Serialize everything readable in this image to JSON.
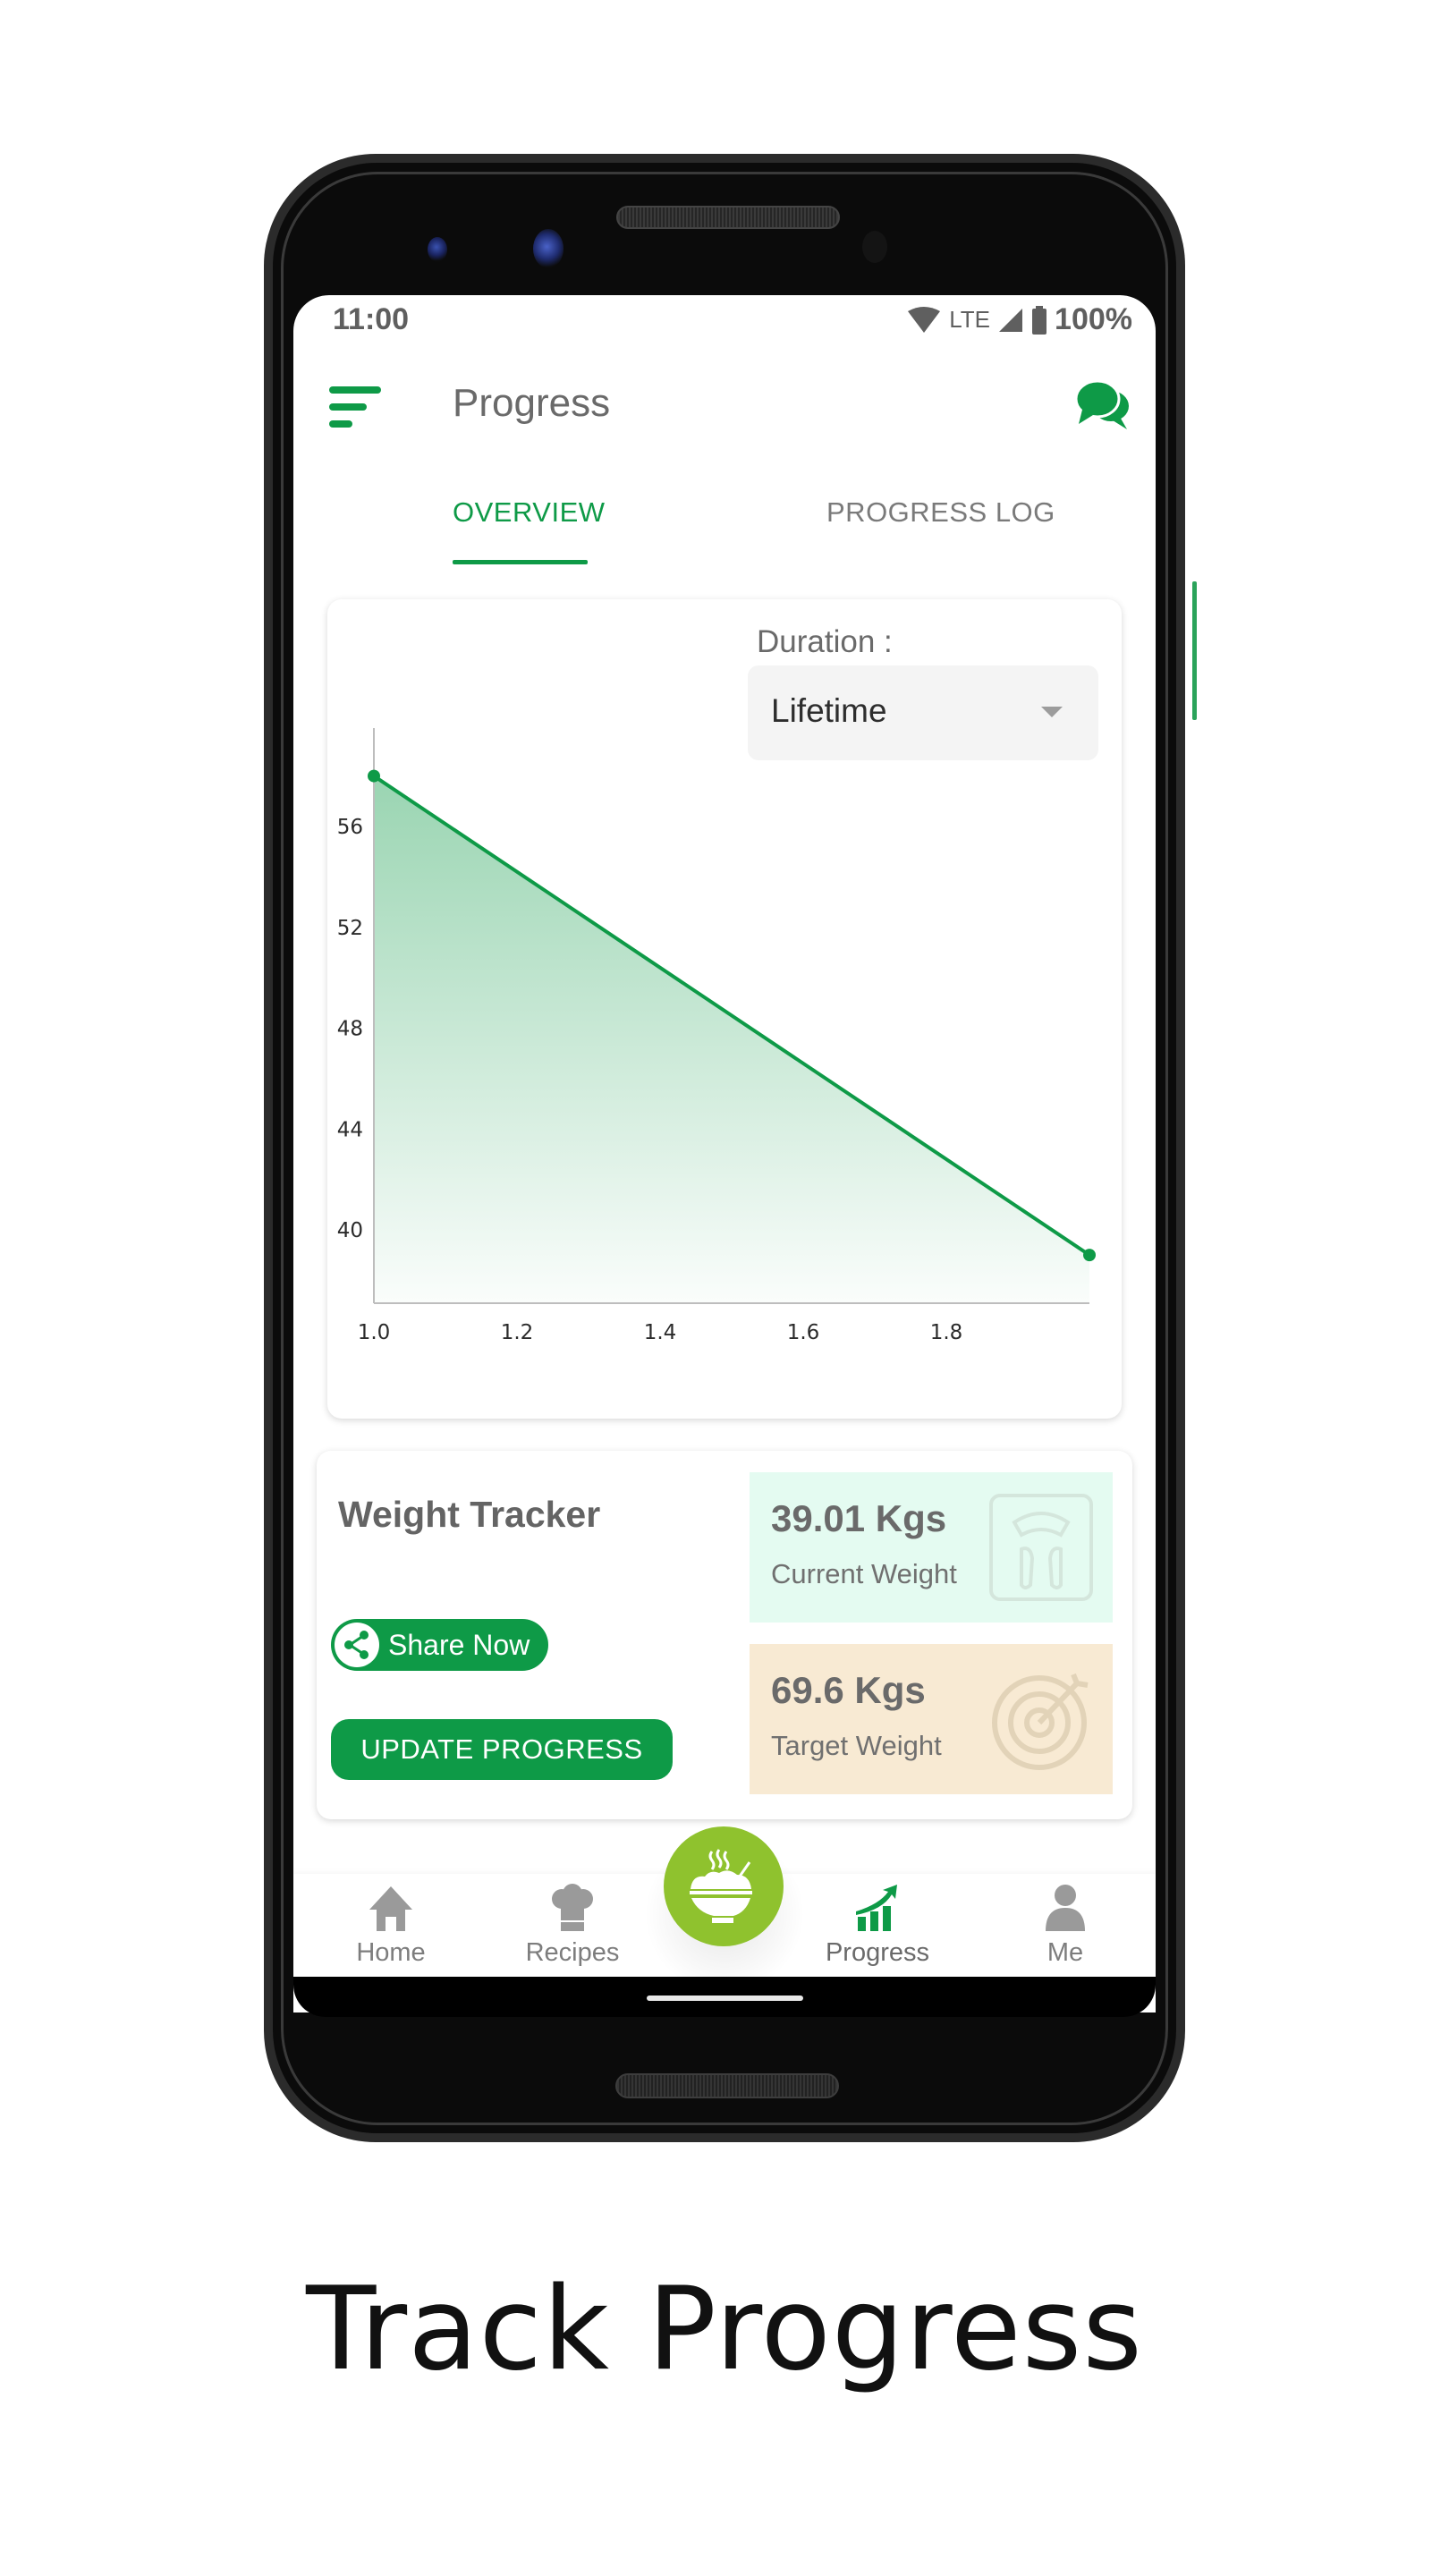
{
  "status_bar": {
    "time": "11:00",
    "network": "LTE",
    "battery": "100%"
  },
  "header": {
    "title": "Progress",
    "menu_icon": "hamburger-menu-icon",
    "chat_icon": "chat-bubbles-icon"
  },
  "tabs": [
    {
      "label": "OVERVIEW",
      "active": true
    },
    {
      "label": "PROGRESS LOG",
      "active": false
    }
  ],
  "duration": {
    "label": "Duration :",
    "selected": "Lifetime"
  },
  "chart_data": {
    "type": "area",
    "title": "",
    "xlabel": "",
    "ylabel": "",
    "x": [
      1.0,
      2.0
    ],
    "series": [
      {
        "name": "Weight",
        "values": [
          58.0,
          39.01
        ]
      }
    ],
    "x_ticks": [
      "1.0",
      "1.2",
      "1.4",
      "1.6",
      "1.8"
    ],
    "y_ticks": [
      "56",
      "52",
      "48",
      "44",
      "40"
    ],
    "xlim": [
      1.0,
      2.0
    ],
    "ylim": [
      37.1,
      59.9
    ],
    "grid": false,
    "legend": "none",
    "line_color": "#0e9a47",
    "fill_color": "#0e9a47"
  },
  "weight_tracker": {
    "title": "Weight Tracker",
    "share_label": "Share Now",
    "update_label": "UPDATE PROGRESS",
    "current": {
      "value": "39.01 Kgs",
      "label": "Current Weight",
      "icon": "weighing-scale-icon"
    },
    "target": {
      "value": "69.6 Kgs",
      "label": "Target Weight",
      "icon": "target-icon"
    }
  },
  "bottom_nav": {
    "items": [
      {
        "label": "Home",
        "icon": "home-icon"
      },
      {
        "label": "Recipes",
        "icon": "chef-hat-icon"
      },
      {
        "label": "Progress",
        "icon": "growth-chart-icon",
        "active": true
      },
      {
        "label": "Me",
        "icon": "user-icon"
      }
    ],
    "fab_icon": "food-bowl-icon"
  },
  "colors": {
    "brand_green": "#0e9a47",
    "fab_green": "#8fc22e",
    "current_bg": "#e4fbf1",
    "target_bg": "#f8ead3"
  },
  "caption": "Track Progress"
}
